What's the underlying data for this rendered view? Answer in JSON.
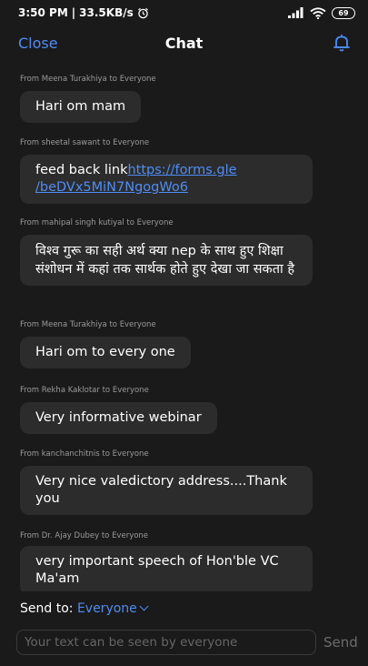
{
  "status_bar": {
    "time": "3:50 PM",
    "separator": "|",
    "speed": "33.5KB/s",
    "battery": "69"
  },
  "header": {
    "close_label": "Close",
    "title": "Chat",
    "bell_icon": "bell-icon"
  },
  "messages": [
    {
      "sender": "From Meena Turakhiya to Everyone",
      "text": "Hari om mam"
    },
    {
      "sender": "From sheetal sawant to Everyone",
      "text": "feed back link",
      "link": "https://forms.gle/beDVx5MiN7NgogWo6",
      "link_line1": "https://forms.gle",
      "link_line2": "/beDVx5MiN7NgogWo6"
    },
    {
      "sender": "From mahipal  singh kutiyal to Everyone",
      "text": "विश्व  गुरू का सही अर्थ क्या nep  के साथ हुए शिक्षा संशोधन में कहां तक सार्थक होते हुए देखा जा सकता है"
    },
    {
      "sender": "From Meena Turakhiya to Everyone",
      "text": "Hari om to every one"
    },
    {
      "sender": "From Rekha Kaklotar to Everyone",
      "text": "Very informative webinar"
    },
    {
      "sender": "From kanchanchitnis to Everyone",
      "text": "Very nice valedictory address....Thank you"
    },
    {
      "sender": "From Dr. Ajay Dubey to Everyone",
      "text": "very important speech of Hon'ble VC Ma'am"
    }
  ],
  "send_to": {
    "label": "Send to:",
    "value": "Everyone"
  },
  "composer": {
    "placeholder": "Your text can be seen by everyone",
    "send_label": "Send"
  }
}
